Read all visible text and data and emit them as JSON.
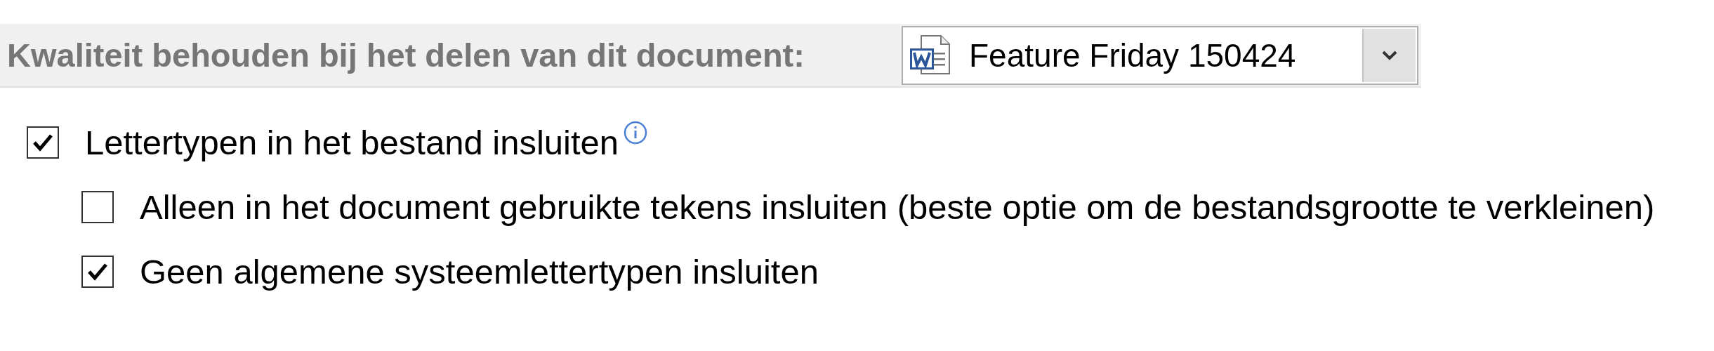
{
  "header": {
    "label": "Kwaliteit behouden bij het delen van dit document:",
    "document_select": {
      "value": "Feature Friday 150424"
    }
  },
  "options": [
    {
      "label": "Lettertypen in het bestand insluiten",
      "checked": true,
      "info": true,
      "children": [
        {
          "label": "Alleen in het document gebruikte tekens insluiten (beste optie om de bestandsgrootte te verkleinen)",
          "checked": false,
          "info": false
        },
        {
          "label": "Geen algemene systeemlettertypen insluiten",
          "checked": true,
          "info": false
        }
      ]
    }
  ]
}
